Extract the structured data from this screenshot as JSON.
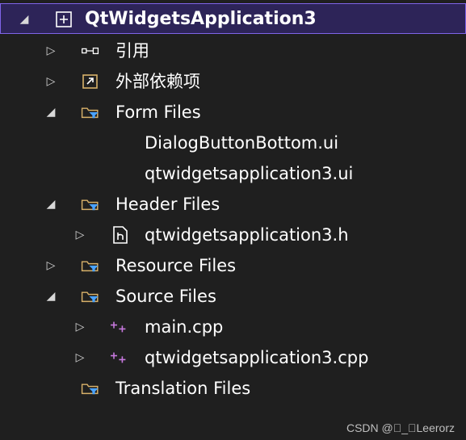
{
  "tree": {
    "project": {
      "label": "QtWidgetsApplication3",
      "icon": "project-icon"
    },
    "items": [
      {
        "label": "引用",
        "icon": "references-icon",
        "expanded": false
      },
      {
        "label": "外部依赖项",
        "icon": "external-dependencies-icon",
        "expanded": false
      },
      {
        "label": "Form Files",
        "icon": "filter-folder-icon",
        "expanded": true
      },
      {
        "label": "DialogButtonBottom.ui",
        "icon": "",
        "expanded": null
      },
      {
        "label": "qtwidgetsapplication3.ui",
        "icon": "",
        "expanded": null
      },
      {
        "label": "Header Files",
        "icon": "filter-folder-icon",
        "expanded": true
      },
      {
        "label": "qtwidgetsapplication3.h",
        "icon": "header-file-icon",
        "expanded": false
      },
      {
        "label": "Resource Files",
        "icon": "filter-folder-icon",
        "expanded": false
      },
      {
        "label": "Source Files",
        "icon": "filter-folder-icon",
        "expanded": true
      },
      {
        "label": "main.cpp",
        "icon": "cpp-file-icon",
        "expanded": false
      },
      {
        "label": "qtwidgetsapplication3.cpp",
        "icon": "cpp-file-icon",
        "expanded": false
      },
      {
        "label": "Translation Files",
        "icon": "filter-folder-icon",
        "expanded": null
      }
    ]
  },
  "colors": {
    "background": "#1f1f1f",
    "selection": "#2d2458",
    "selection_border": "#7f64e8",
    "folder": "#d8b16a",
    "filter": "#4aa3ff",
    "cpp": "#c678dd"
  },
  "watermark": "CSDN @\u0000_\u0000Leerorz"
}
